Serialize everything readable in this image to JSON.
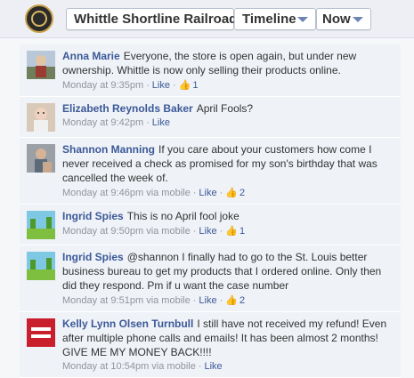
{
  "page": {
    "title": "Whittle Shortline Railroad",
    "timeline_label": "Timeline",
    "now_label": "Now"
  },
  "comments": [
    {
      "author": "Anna Marie",
      "text": "Everyone, the store is open again, but under new ownership. Whittle is now only selling their products online.",
      "timestamp": "Monday at 9:35pm",
      "like_label": "Like",
      "like_count": "1"
    },
    {
      "author": "Elizabeth Reynolds Baker",
      "text": "April Fools?",
      "timestamp": "Monday at 9:42pm",
      "like_label": "Like"
    },
    {
      "author": "Shannon Manning",
      "text": "If you care about your customers how come I never received a check as promised for my son's birthday that was cancelled the week of.",
      "timestamp": "Monday at 9:46pm",
      "via": "via mobile",
      "like_label": "Like",
      "like_count": "2"
    },
    {
      "author": "Ingrid Spies",
      "text": "This is no April fool joke",
      "timestamp": "Monday at 9:50pm",
      "via": "via mobile",
      "like_label": "Like",
      "like_count": "1"
    },
    {
      "author": "Ingrid Spies",
      "text": "@shannon I finally had to go to the St. Louis better business bureau to get my products that I ordered online. Only then did they respond. Pm if u want the case number",
      "timestamp": "Monday at 9:51pm",
      "via": "via mobile",
      "like_label": "Like",
      "like_count": "2"
    },
    {
      "author": "Kelly Lynn Olsen Turnbull",
      "text": "I still have not received my refund! Even after multiple phone calls and emails! It has been almost 2 months! GIVE ME MY MONEY BACK!!!!",
      "timestamp": "Monday at 10:54pm",
      "via": "via mobile",
      "like_label": "Like"
    }
  ]
}
